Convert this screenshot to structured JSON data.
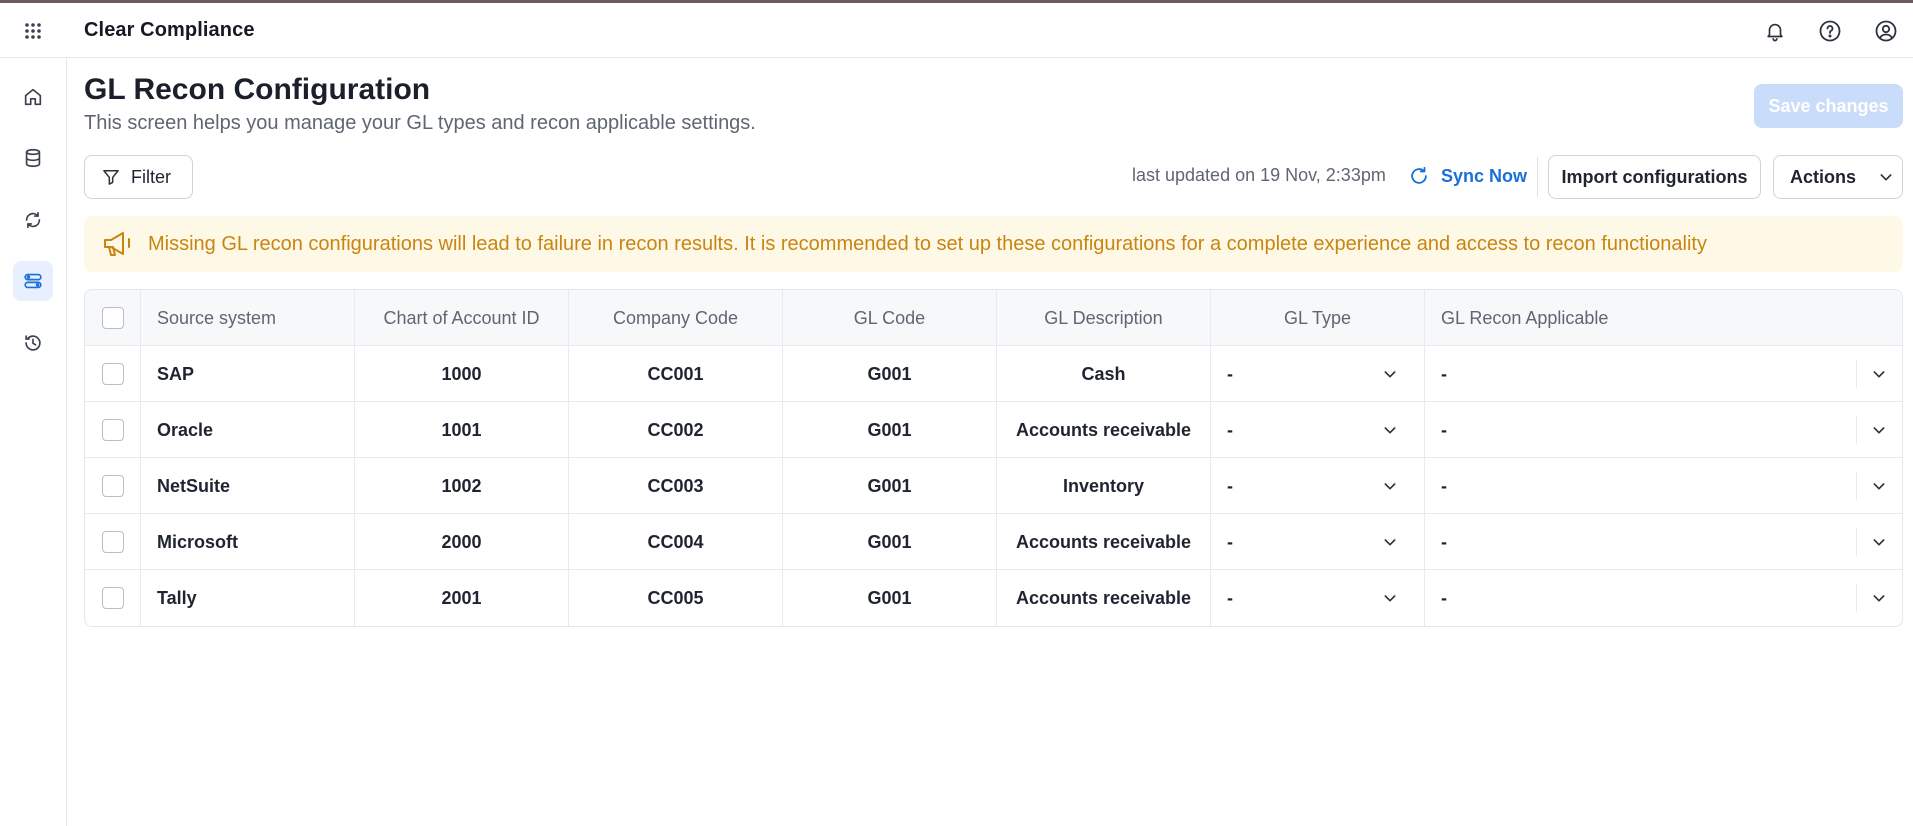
{
  "app": {
    "title": "Clear Compliance"
  },
  "topbar": {
    "icons": [
      "apps-grid-icon",
      "bell-icon",
      "help-icon",
      "user-icon"
    ]
  },
  "sidebar": {
    "items": [
      {
        "name": "home",
        "icon": "home-icon",
        "active": false
      },
      {
        "name": "data",
        "icon": "database-icon",
        "active": false
      },
      {
        "name": "sync",
        "icon": "refresh-icon",
        "active": false
      },
      {
        "name": "config",
        "icon": "settings-list-icon",
        "active": true
      },
      {
        "name": "history",
        "icon": "history-icon",
        "active": false
      }
    ]
  },
  "page": {
    "title": "GL Recon Configuration",
    "subtitle": "This screen helps you manage your GL types and recon applicable settings.",
    "save_label": "Save changes"
  },
  "toolbar": {
    "filter_label": "Filter",
    "last_updated": "last updated on 19 Nov, 2:33pm",
    "sync_label": "Sync Now",
    "import_label": "Import configurations",
    "actions_label": "Actions"
  },
  "banner": {
    "icon": "megaphone-icon",
    "text": "Missing GL recon configurations will lead to failure in recon results. It is recommended to set up these configurations for a complete experience and access to recon functionality"
  },
  "table": {
    "columns": [
      "Source system",
      "Chart of Account ID",
      "Company Code",
      "GL Code",
      "GL Description",
      "GL Type",
      "GL Recon Applicable"
    ],
    "rows": [
      {
        "source": "SAP",
        "coa": "1000",
        "company": "CC001",
        "gl_code": "G001",
        "description": "Cash",
        "gl_type": "-",
        "recon": "-"
      },
      {
        "source": "Oracle",
        "coa": "1001",
        "company": "CC002",
        "gl_code": "G001",
        "description": "Accounts receivable",
        "gl_type": "-",
        "recon": "-"
      },
      {
        "source": "NetSuite",
        "coa": "1002",
        "company": "CC003",
        "gl_code": "G001",
        "description": "Inventory",
        "gl_type": "-",
        "recon": "-"
      },
      {
        "source": "Microsoft",
        "coa": "2000",
        "company": "CC004",
        "gl_code": "G001",
        "description": "Accounts receivable",
        "gl_type": "-",
        "recon": "-"
      },
      {
        "source": "Tally",
        "coa": "2001",
        "company": "CC005",
        "gl_code": "G001",
        "description": "Accounts receivable",
        "gl_type": "-",
        "recon": "-"
      }
    ]
  },
  "colors": {
    "accent": "#1a6fd8",
    "banner_bg": "#fef8e6",
    "banner_text": "#c98512",
    "save_disabled": "#c9dcfa"
  }
}
